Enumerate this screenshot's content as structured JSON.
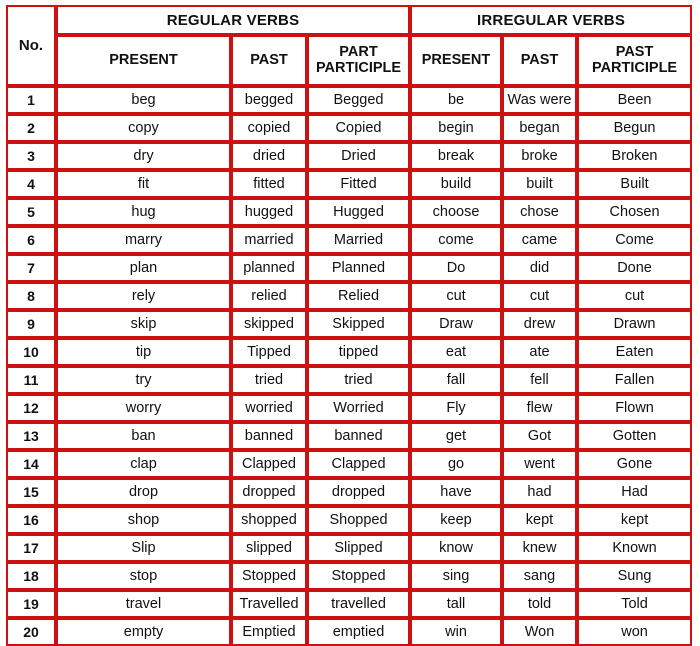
{
  "table": {
    "no_header": "No.",
    "groups": [
      {
        "label": "REGULAR VERBS",
        "span": 3
      },
      {
        "label": "IRREGULAR VERBS",
        "span": 3
      }
    ],
    "subheaders": [
      {
        "line1": "PRESENT",
        "line2": ""
      },
      {
        "line1": "PAST",
        "line2": ""
      },
      {
        "line1": "PART",
        "line2": "PARTICIPLE"
      },
      {
        "line1": "PRESENT",
        "line2": ""
      },
      {
        "line1": "PAST",
        "line2": ""
      },
      {
        "line1": "PAST",
        "line2": "PARTICIPLE"
      }
    ],
    "colors": {
      "border_red": "#CC1111",
      "header_pink": "#DC8C8A",
      "cell_background": "#FFFFFF",
      "text": "#111111"
    },
    "rows": [
      {
        "no": "1",
        "reg_present": "beg",
        "reg_past": "begged",
        "reg_pp": "Begged",
        "irr_present": "be",
        "irr_past": "Was were",
        "irr_pp": "Been"
      },
      {
        "no": "2",
        "reg_present": "copy",
        "reg_past": "copied",
        "reg_pp": "Copied",
        "irr_present": "begin",
        "irr_past": "began",
        "irr_pp": "Begun"
      },
      {
        "no": "3",
        "reg_present": "dry",
        "reg_past": "dried",
        "reg_pp": "Dried",
        "irr_present": "break",
        "irr_past": "broke",
        "irr_pp": "Broken"
      },
      {
        "no": "4",
        "reg_present": "fit",
        "reg_past": "fitted",
        "reg_pp": "Fitted",
        "irr_present": "build",
        "irr_past": "built",
        "irr_pp": "Built"
      },
      {
        "no": "5",
        "reg_present": "hug",
        "reg_past": "hugged",
        "reg_pp": "Hugged",
        "irr_present": "choose",
        "irr_past": "chose",
        "irr_pp": "Chosen"
      },
      {
        "no": "6",
        "reg_present": "marry",
        "reg_past": "married",
        "reg_pp": "Married",
        "irr_present": "come",
        "irr_past": "came",
        "irr_pp": "Come"
      },
      {
        "no": "7",
        "reg_present": "plan",
        "reg_past": "planned",
        "reg_pp": "Planned",
        "irr_present": "Do",
        "irr_past": "did",
        "irr_pp": "Done"
      },
      {
        "no": "8",
        "reg_present": "rely",
        "reg_past": "relied",
        "reg_pp": "Relied",
        "irr_present": "cut",
        "irr_past": "cut",
        "irr_pp": "cut"
      },
      {
        "no": "9",
        "reg_present": "skip",
        "reg_past": "skipped",
        "reg_pp": "Skipped",
        "irr_present": "Draw",
        "irr_past": "drew",
        "irr_pp": "Drawn"
      },
      {
        "no": "10",
        "reg_present": "tip",
        "reg_past": "Tipped",
        "reg_pp": "tipped",
        "irr_present": "eat",
        "irr_past": "ate",
        "irr_pp": "Eaten"
      },
      {
        "no": "11",
        "reg_present": "try",
        "reg_past": "tried",
        "reg_pp": "tried",
        "irr_present": "fall",
        "irr_past": "fell",
        "irr_pp": "Fallen"
      },
      {
        "no": "12",
        "reg_present": "worry",
        "reg_past": "worried",
        "reg_pp": "Worried",
        "irr_present": "Fly",
        "irr_past": "flew",
        "irr_pp": "Flown"
      },
      {
        "no": "13",
        "reg_present": "ban",
        "reg_past": "banned",
        "reg_pp": "banned",
        "irr_present": "get",
        "irr_past": "Got",
        "irr_pp": "Gotten"
      },
      {
        "no": "14",
        "reg_present": "clap",
        "reg_past": "Clapped",
        "reg_pp": "Clapped",
        "irr_present": "go",
        "irr_past": "went",
        "irr_pp": "Gone"
      },
      {
        "no": "15",
        "reg_present": "drop",
        "reg_past": "dropped",
        "reg_pp": "dropped",
        "irr_present": "have",
        "irr_past": "had",
        "irr_pp": "Had"
      },
      {
        "no": "16",
        "reg_present": "shop",
        "reg_past": "shopped",
        "reg_pp": "Shopped",
        "irr_present": "keep",
        "irr_past": "kept",
        "irr_pp": "kept"
      },
      {
        "no": "17",
        "reg_present": "Slip",
        "reg_past": "slipped",
        "reg_pp": "Slipped",
        "irr_present": "know",
        "irr_past": "knew",
        "irr_pp": "Known"
      },
      {
        "no": "18",
        "reg_present": "stop",
        "reg_past": "Stopped",
        "reg_pp": "Stopped",
        "irr_present": "sing",
        "irr_past": "sang",
        "irr_pp": "Sung"
      },
      {
        "no": "19",
        "reg_present": "travel",
        "reg_past": "Travelled",
        "reg_pp": "travelled",
        "irr_present": "tall",
        "irr_past": "told",
        "irr_pp": "Told"
      },
      {
        "no": "20",
        "reg_present": "empty",
        "reg_past": "Emptied",
        "reg_pp": "emptied",
        "irr_present": "win",
        "irr_past": "Won",
        "irr_pp": "won"
      }
    ]
  }
}
